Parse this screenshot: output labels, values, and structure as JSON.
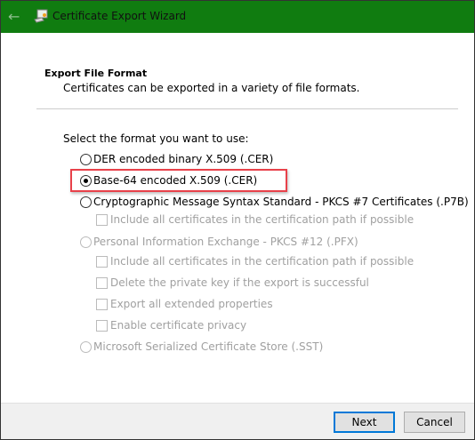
{
  "window": {
    "title": "Certificate Export Wizard"
  },
  "header": {
    "title": "Export File Format",
    "subtitle": "Certificates can be exported in a variety of file formats."
  },
  "prompt": "Select the format you want to use:",
  "options": [
    {
      "label": "DER encoded binary X.509 (.CER)",
      "type": "radio",
      "checked": false,
      "enabled": true
    },
    {
      "label": "Base-64 encoded X.509 (.CER)",
      "type": "radio",
      "checked": true,
      "enabled": true,
      "highlighted": true
    },
    {
      "label": "Cryptographic Message Syntax Standard - PKCS #7 Certificates (.P7B)",
      "type": "radio",
      "checked": false,
      "enabled": true
    },
    {
      "label": "Include all certificates in the certification path if possible",
      "type": "checkbox",
      "checked": false,
      "enabled": false
    },
    {
      "label": "Personal Information Exchange - PKCS #12 (.PFX)",
      "type": "radio",
      "checked": false,
      "enabled": false
    },
    {
      "label": "Include all certificates in the certification path if possible",
      "type": "checkbox",
      "checked": false,
      "enabled": false
    },
    {
      "label": "Delete the private key if the export is successful",
      "type": "checkbox",
      "checked": false,
      "enabled": false
    },
    {
      "label": "Export all extended properties",
      "type": "checkbox",
      "checked": false,
      "enabled": false
    },
    {
      "label": "Enable certificate privacy",
      "type": "checkbox",
      "checked": false,
      "enabled": false
    },
    {
      "label": "Microsoft Serialized Certificate Store (.SST)",
      "type": "radio",
      "checked": false,
      "enabled": false
    }
  ],
  "footer": {
    "next_label": "Next",
    "cancel_label": "Cancel"
  },
  "colors": {
    "titlebar": "#107c10",
    "highlight": "#e8414a",
    "default_button": "#0078d7"
  }
}
